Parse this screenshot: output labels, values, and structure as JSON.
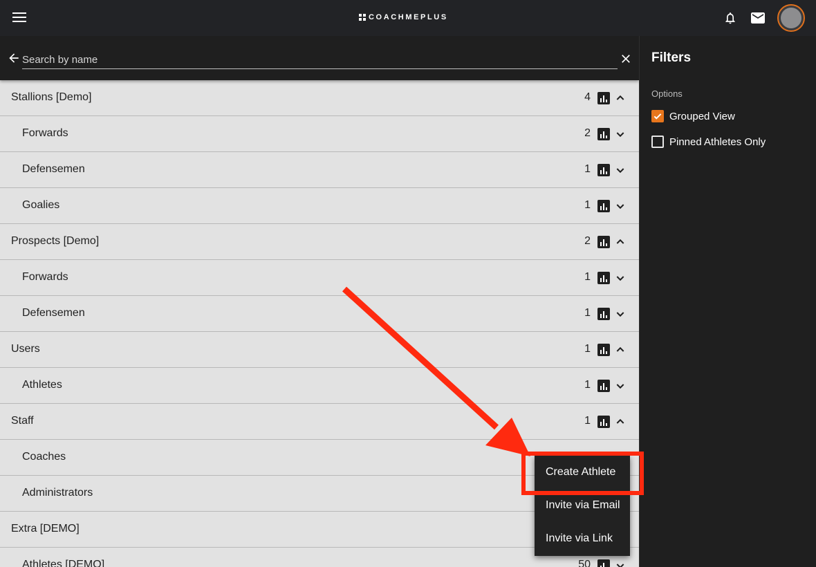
{
  "app": {
    "logo_text": "COACHMEPLUS"
  },
  "search": {
    "placeholder": "Search by name",
    "value": ""
  },
  "groups": [
    {
      "label": "Stallions [Demo]",
      "count": "4",
      "level": 0,
      "expanded": true
    },
    {
      "label": "Forwards",
      "count": "2",
      "level": 1,
      "expanded": false
    },
    {
      "label": "Defensemen",
      "count": "1",
      "level": 1,
      "expanded": false
    },
    {
      "label": "Goalies",
      "count": "1",
      "level": 1,
      "expanded": false
    },
    {
      "label": "Prospects [Demo]",
      "count": "2",
      "level": 0,
      "expanded": true
    },
    {
      "label": "Forwards",
      "count": "1",
      "level": 1,
      "expanded": false
    },
    {
      "label": "Defensemen",
      "count": "1",
      "level": 1,
      "expanded": false
    },
    {
      "label": "Users",
      "count": "1",
      "level": 0,
      "expanded": true
    },
    {
      "label": "Athletes",
      "count": "1",
      "level": 1,
      "expanded": false
    },
    {
      "label": "Staff",
      "count": "1",
      "level": 0,
      "expanded": true
    },
    {
      "label": "Coaches",
      "count": "",
      "level": 1,
      "expanded": false
    },
    {
      "label": "Administrators",
      "count": "",
      "level": 1,
      "expanded": false
    },
    {
      "label": "Extra [DEMO]",
      "count": "",
      "level": 0,
      "expanded": true
    },
    {
      "label": "Athletes [DEMO]",
      "count": "50",
      "level": 1,
      "expanded": false
    }
  ],
  "filters": {
    "title": "Filters",
    "options_label": "Options",
    "options": [
      {
        "label": "Grouped View",
        "checked": true
      },
      {
        "label": "Pinned Athletes Only",
        "checked": false
      }
    ]
  },
  "menu": {
    "items": [
      "Create Athlete",
      "Invite via Email",
      "Invite via Link"
    ]
  },
  "colors": {
    "accent": "#e8761c",
    "annotation": "#ff2a0f"
  },
  "icons": {
    "menu": "hamburger-icon",
    "bell": "bell-icon",
    "mail": "mail-icon",
    "back": "arrow-left-icon",
    "clear": "close-icon",
    "stats": "bar-chart-icon",
    "expand": "chevron-icon"
  }
}
